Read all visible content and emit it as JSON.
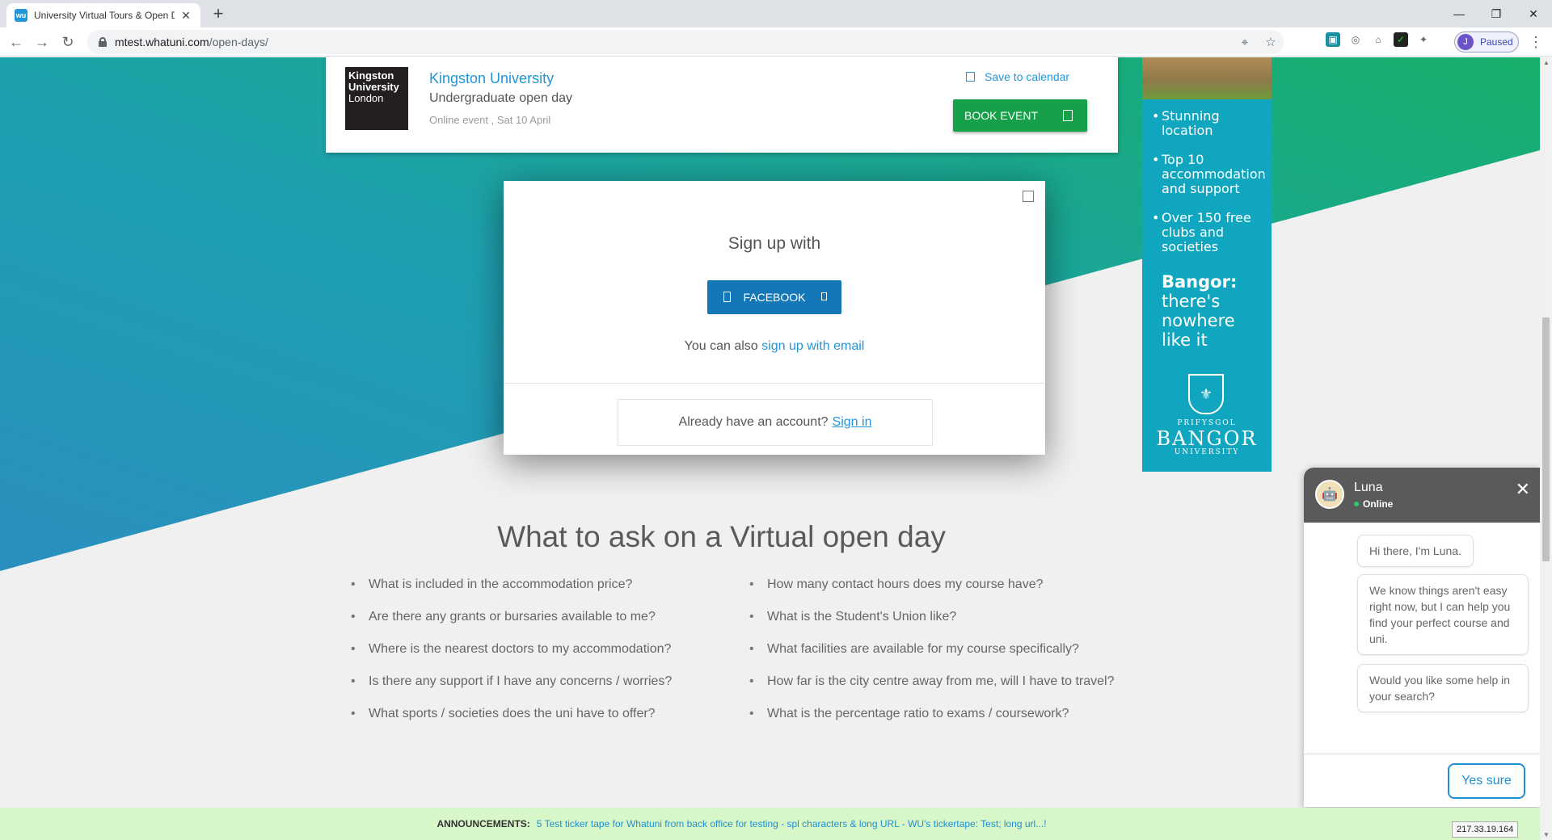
{
  "browser": {
    "tab_title": "University Virtual Tours & Open D",
    "tab_favicon": "wu",
    "url_host": "mtest.whatuni.com",
    "url_path": "/open-days/",
    "profile_initial": "J",
    "profile_status": "Paused"
  },
  "event_card": {
    "logo_line1": "Kingston",
    "logo_line2": "University",
    "logo_line3": "London",
    "university": "Kingston University",
    "event_type": "Undergraduate open day",
    "meta": "Online event , Sat 10 April",
    "save_label": "Save to calendar",
    "book_label": "BOOK EVENT"
  },
  "ad": {
    "bullets": [
      "Stunning location",
      "Top 10 accommodation and support",
      "Over 150 free clubs and societies"
    ],
    "tag_bold": "Bangor:",
    "tag_rest": "there's nowhere like it",
    "pre": "PRIFYSGOL",
    "brand": "BANGOR",
    "post": "UNIVERSITY"
  },
  "modal": {
    "title": "Sign up with",
    "facebook_label": "FACEBOOK",
    "also_prefix": "You can also",
    "also_link": "sign up with email",
    "account_prefix": "Already have an account?",
    "signin_link": "Sign in"
  },
  "section": {
    "title": "What to ask on a Virtual open day",
    "left_questions": [
      "What is included in the accommodation price?",
      "Are there any grants or bursaries available to me?",
      "Where is the nearest doctors to my accommodation?",
      "Is there any support if I have any concerns / worries?",
      "What sports / societies does the uni have to offer?"
    ],
    "right_questions": [
      "How many contact hours does my course have?",
      "What is the Student's Union like?",
      "What facilities are available for my course specifically?",
      "How far is the city centre away from me, will I have to travel?",
      "What is the percentage ratio to exams / coursework?"
    ]
  },
  "chat": {
    "name": "Luna",
    "status": "Online",
    "messages": [
      "Hi there, I'm Luna.",
      "We know things aren't easy right now, but I can help you find your perfect course and uni.",
      "Would you like some help in your search?"
    ],
    "reply_button": "Yes sure"
  },
  "announcement": {
    "label": "ANNOUNCEMENTS:",
    "text": "5 Test ticker tape for Whatuni from back office for testing - spl characters & long URL - WU's tickertape: Test; long url...!"
  },
  "ip_address": "217.33.19.164",
  "colors": {
    "brand_blue": "#2196d8",
    "book_green": "#17a04a",
    "facebook_blue": "#1477b8",
    "ad_teal": "#10a6bf",
    "hero_teal": "#1b9fb3",
    "hero_green": "#18a86b"
  }
}
